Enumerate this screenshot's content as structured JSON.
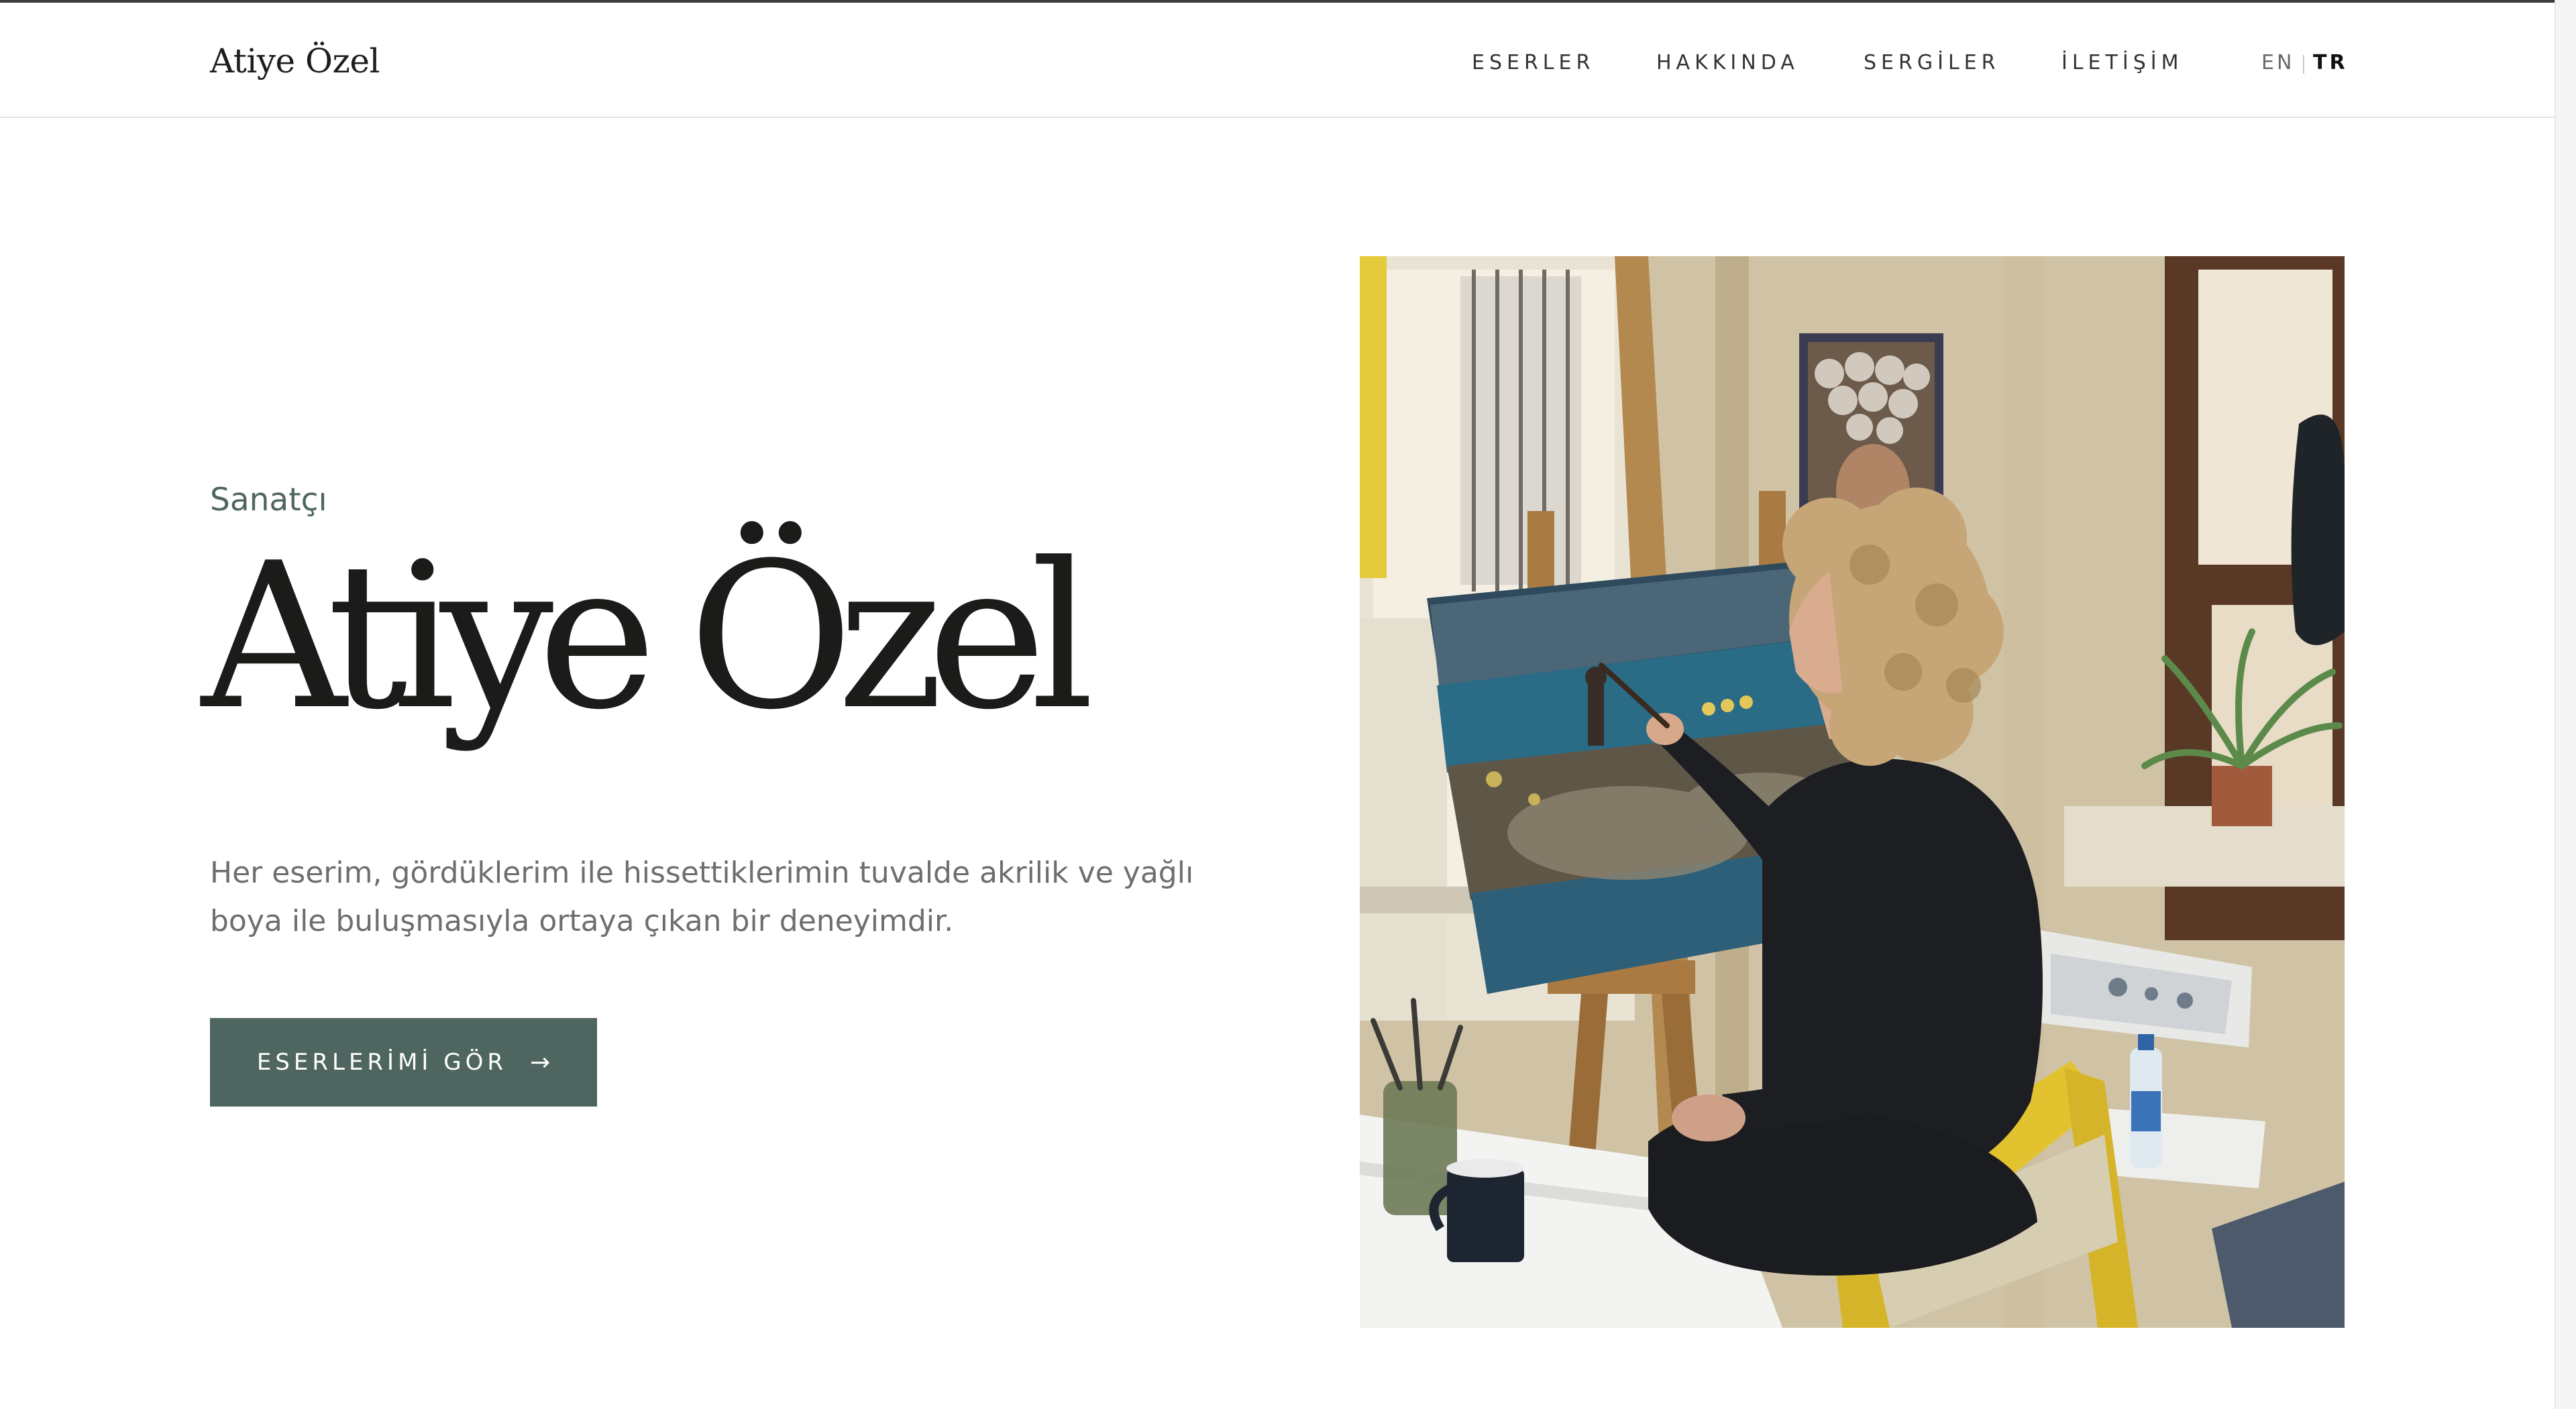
{
  "site": {
    "logo": "Atiye Özel"
  },
  "nav": {
    "items": [
      {
        "label": "ESERLER"
      },
      {
        "label": "HAKKINDA"
      },
      {
        "label": "SERGİLER"
      },
      {
        "label": "İLETİŞİM"
      }
    ],
    "languages": {
      "en": "EN",
      "tr": "TR",
      "active": "TR"
    }
  },
  "hero": {
    "eyebrow": "Sanatçı",
    "title": "Atiye Özel",
    "intro": "Her eserim, gördüklerim ile hissettiklerimin tuvalde akrilik ve yağlı boya ile buluşmasıyla ortaya çıkan bir deneyimdir.",
    "cta_label": "ESERLERİMİ GÖR",
    "cta_icon": "arrow-right-icon"
  },
  "colors": {
    "accent": "#4e6560",
    "eyebrow": "#4f6560",
    "body_text": "#6e6e6e",
    "title": "#1b1b19"
  }
}
